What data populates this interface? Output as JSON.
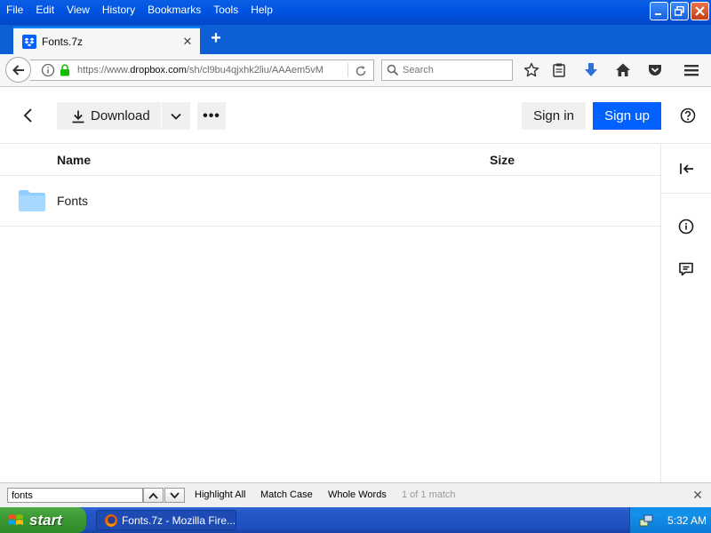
{
  "window": {
    "menu": [
      "File",
      "Edit",
      "View",
      "History",
      "Bookmarks",
      "Tools",
      "Help"
    ]
  },
  "tab": {
    "title": "Fonts.7z",
    "new_tab_label": "+"
  },
  "navbar": {
    "url_prefix": "https://www.",
    "url_domain": "dropbox.com",
    "url_rest": "/sh/cl9bu4qjxhk2liu/AAAem5vM",
    "search_placeholder": "Search"
  },
  "dropbox": {
    "download_label": "Download",
    "more_label": "•••",
    "signin_label": "Sign in",
    "signup_label": "Sign up",
    "columns": {
      "name": "Name",
      "size": "Size"
    },
    "files": [
      {
        "name": "Fonts",
        "type": "folder"
      }
    ],
    "colors": {
      "primary": "#0061fe",
      "folder": "#92ceff"
    }
  },
  "findbar": {
    "query": "fonts",
    "highlight_all": "Highlight All",
    "match_case": "Match Case",
    "whole_words": "Whole Words",
    "status": "1 of 1 match"
  },
  "taskbar": {
    "start_label": "start",
    "window_label": "Fonts.7z - Mozilla Fire...",
    "clock": "5:32 AM"
  }
}
